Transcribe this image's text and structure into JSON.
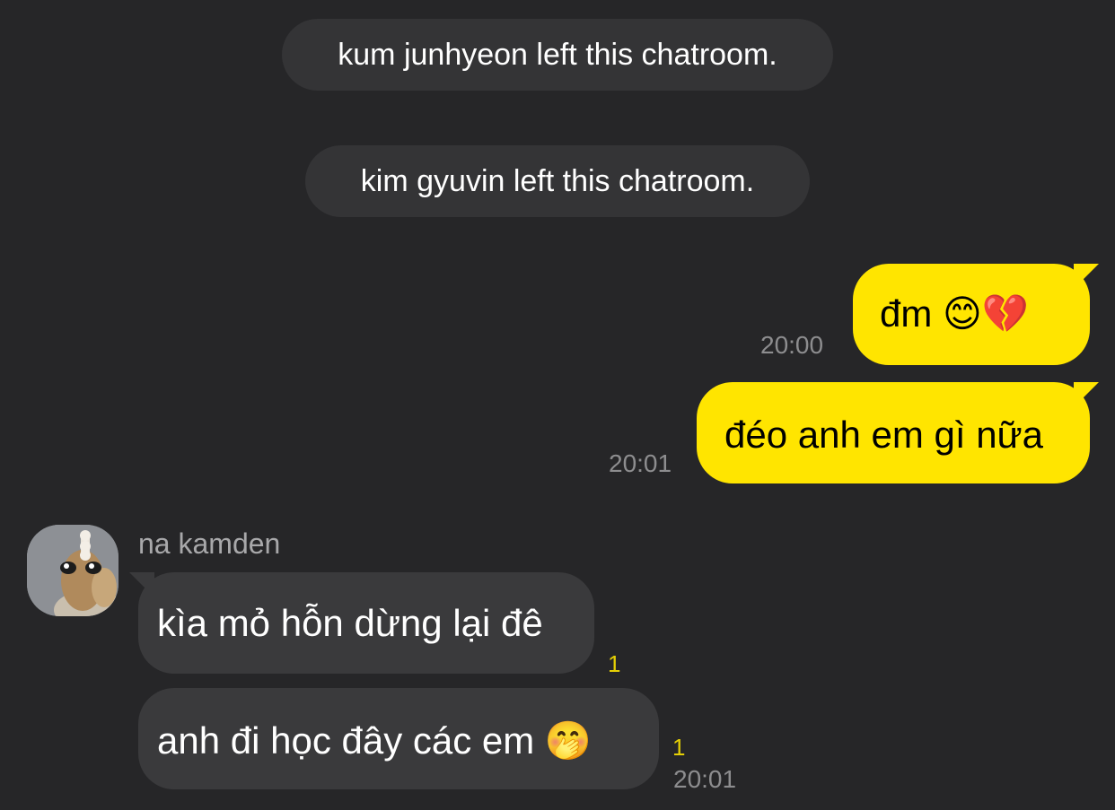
{
  "system_messages": [
    {
      "text": "kum junhyeon left this chatroom."
    },
    {
      "text": "kim gyuvin left this chatroom."
    }
  ],
  "outgoing": [
    {
      "text": "đm",
      "emoji": [
        "😊",
        "💔"
      ],
      "emoji_names": [
        "smiling-face-icon",
        "broken-heart-icon"
      ],
      "time": "20:00"
    },
    {
      "text": "đéo anh em gì nữa",
      "time": "20:01"
    }
  ],
  "incoming": {
    "sender": "na kamden",
    "avatar": "plush-toy-avatar",
    "messages": [
      {
        "text": "kìa mỏ hỗn dừng lại đê",
        "unread": "1"
      },
      {
        "text": "anh đi học đây các em",
        "emoji": "🤭",
        "emoji_name": "hand-over-mouth-icon",
        "unread": "1",
        "time": "20:01"
      }
    ]
  },
  "colors": {
    "background": "#262628",
    "system_pill": "#343436",
    "outgoing_bubble": "#ffe500",
    "incoming_bubble": "#3a3a3c",
    "timestamp": "#8d8d8f",
    "unread_count": "#e5cf05"
  }
}
